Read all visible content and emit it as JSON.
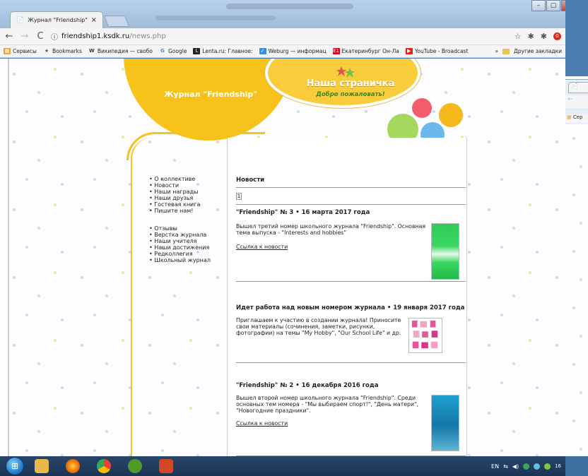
{
  "browser": {
    "tab_title": "Журнал \"Friendship\"",
    "tab_close": "×",
    "address_host": "friendship1.ksdk.ru",
    "address_path": "/news.php",
    "window_buttons": [
      "–",
      "▢",
      "✕"
    ]
  },
  "bookmarks": {
    "items": [
      {
        "label": "Сервисы",
        "icon": "apps-icon",
        "color": "#e8a23a"
      },
      {
        "label": "Bookmarks",
        "icon": "star-icon",
        "color": "#555555"
      },
      {
        "label": "Википедия — свобо",
        "icon": "wikipedia-icon",
        "color": "#333333"
      },
      {
        "label": "Google",
        "icon": "google-icon",
        "color": "#4285f4"
      },
      {
        "label": "Lenta.ru: Главное:",
        "icon": "lenta-icon",
        "color": "#222222"
      },
      {
        "label": "Weburg — информац",
        "icon": "weburg-icon",
        "color": "#3a8ee6"
      },
      {
        "label": "Екатеринбург Он-Ла",
        "icon": "e1-icon",
        "color": "#d0021b"
      },
      {
        "label": "YouTube - Broadcast",
        "icon": "youtube-icon",
        "color": "#e62117"
      }
    ],
    "more": "»",
    "other": "Другие закладки"
  },
  "site": {
    "header_title": "Журнал \"Friendship\"",
    "badge_title": "Наша страничка",
    "badge_subtitle": "Добро пожаловать!",
    "nav_group1": [
      "О коллективе",
      "Новости",
      "Наши награды",
      "Наши друзья",
      "Гостевая книга",
      "Пишите нам!"
    ],
    "nav_group2": [
      "Отзывы",
      "Верстка журнала",
      "Наши учителя",
      "Наши достижения",
      "Редколлегия",
      "Школьный журнал"
    ],
    "section_title": "Новости",
    "page_number": "1",
    "news": [
      {
        "title": "\"Friendship\" № 3 • 16 марта 2017 года",
        "text": "Вышел третий номер школьного журнала \"Friendship\". Основная тема выпуска - \"Interests and hobbies\"",
        "link": "Ссылка к новости"
      },
      {
        "title": "Идет работа над новым номером журнала • 19 января 2017 года",
        "text": "Приглашаем к участию в создании журнала! Приносите свои материалы (сочинения, заметки, рисунки, фотографии) на темы \"My Hobby\", \"Our School Life\" и др.",
        "link": ""
      },
      {
        "title": "\"Friendship\" № 2 • 16 декабря 2016 года",
        "text": "Вышел второй номер школьного журнала \"Friendship\". Среди основных тем номера - \"Мы выбираем спорт!\", \"День матери\", \"Новогодние праздники\".",
        "link": "Ссылка к новости"
      }
    ]
  },
  "right_window": {
    "bookmarks": "Сер"
  },
  "taskbar": {
    "apps": [
      {
        "icon": "windows-start-icon",
        "color": "#1d6fbf"
      },
      {
        "icon": "file-explorer-icon",
        "color": "#e8b84a"
      },
      {
        "icon": "firefox-icon",
        "color": "#e66000"
      },
      {
        "icon": "chrome-icon",
        "color": "#34a853"
      },
      {
        "icon": "utorrent-icon",
        "color": "#4d9a2c"
      },
      {
        "icon": "presentation-app-icon",
        "color": "#d24726"
      }
    ],
    "lang": "EN",
    "clock": "16"
  }
}
